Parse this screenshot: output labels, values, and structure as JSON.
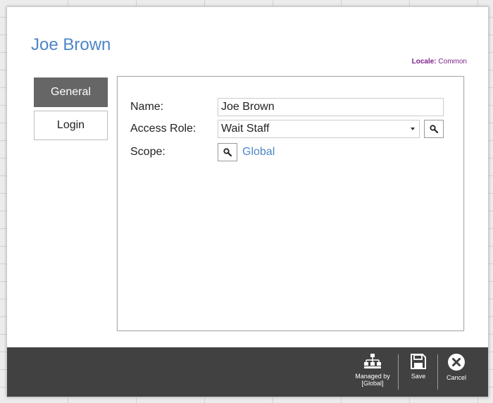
{
  "header": {
    "title": "Joe Brown",
    "locale_label": "Locale:",
    "locale_value": "Common"
  },
  "tabs": [
    {
      "label": "General",
      "active": true
    },
    {
      "label": "Login",
      "active": false
    }
  ],
  "form": {
    "name_label": "Name:",
    "name_value": "Joe Brown",
    "role_label": "Access Role:",
    "role_value": "Wait Staff",
    "scope_label": "Scope:",
    "scope_value": "Global"
  },
  "footer": {
    "managed_by_line1": "Managed by",
    "managed_by_line2": "[Global]",
    "save_label": "Save",
    "cancel_label": "Cancel"
  },
  "colors": {
    "title": "#4d86c6",
    "locale": "#7d1f8f",
    "active_tab": "#666666",
    "footer": "#414141"
  },
  "icons": [
    "search-icon",
    "hierarchy-icon",
    "save-icon",
    "cancel-icon",
    "chevron-down-icon"
  ]
}
